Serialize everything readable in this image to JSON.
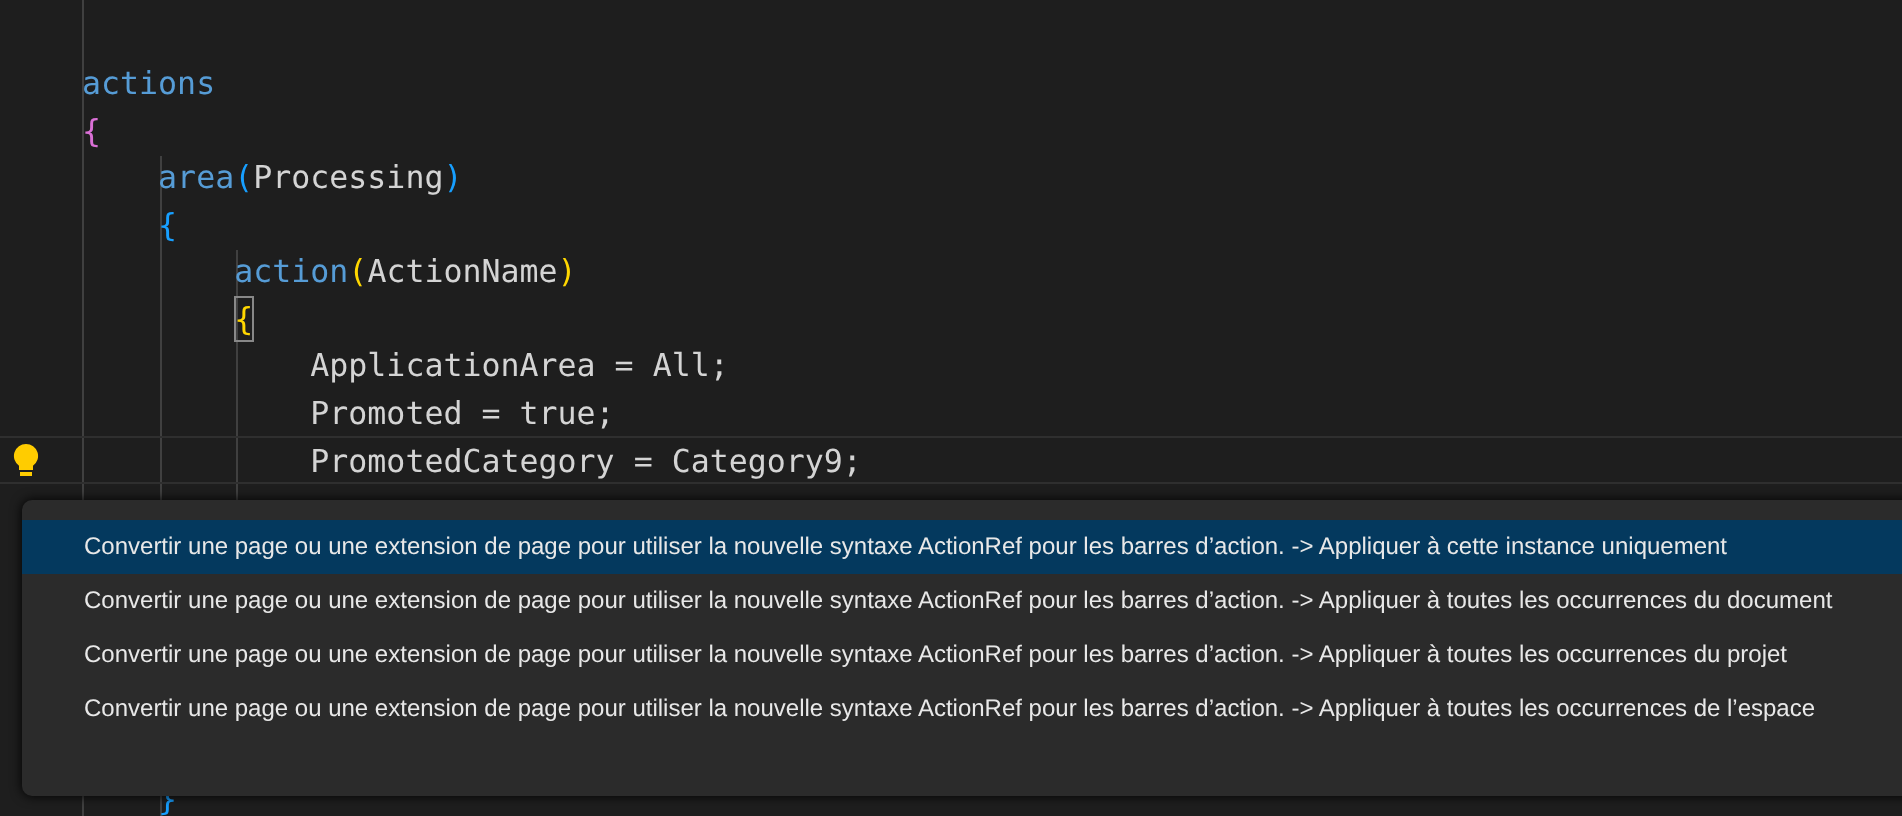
{
  "code_lines": [
    {
      "current": false,
      "lightbulb": false,
      "tokens": [
        {
          "text": "actions",
          "kind": "keyword",
          "highlighted": false
        }
      ]
    },
    {
      "current": false,
      "lightbulb": false,
      "tokens": [
        {
          "text": "{",
          "kind": "bracket2",
          "highlighted": false
        }
      ]
    },
    {
      "current": false,
      "lightbulb": false,
      "tokens": [
        {
          "text": "    area",
          "kind": "keyword",
          "highlighted": false
        },
        {
          "text": "(",
          "kind": "bracket3",
          "highlighted": false
        },
        {
          "text": "Processing",
          "kind": "plain",
          "highlighted": false
        },
        {
          "text": ")",
          "kind": "bracket3",
          "highlighted": false
        }
      ]
    },
    {
      "current": false,
      "lightbulb": false,
      "tokens": [
        {
          "text": "    {",
          "kind": "bracket3",
          "highlighted": false
        }
      ]
    },
    {
      "current": false,
      "lightbulb": false,
      "tokens": [
        {
          "text": "        action",
          "kind": "keyword",
          "highlighted": false
        },
        {
          "text": "(",
          "kind": "bracket1",
          "highlighted": false
        },
        {
          "text": "ActionName",
          "kind": "plain",
          "highlighted": false
        },
        {
          "text": ")",
          "kind": "bracket1",
          "highlighted": false
        }
      ]
    },
    {
      "current": false,
      "lightbulb": false,
      "tokens": [
        {
          "text": "        {",
          "kind": "bracket1",
          "highlighted": true
        }
      ]
    },
    {
      "current": false,
      "lightbulb": false,
      "tokens": [
        {
          "text": "            ApplicationArea = All;",
          "kind": "plain",
          "highlighted": false
        }
      ]
    },
    {
      "current": false,
      "lightbulb": false,
      "tokens": [
        {
          "text": "            Promoted = true;",
          "kind": "plain",
          "highlighted": false
        }
      ]
    },
    {
      "current": true,
      "lightbulb": true,
      "tokens": [
        {
          "text": "            PromotedCategory = Category9;",
          "kind": "plain",
          "highlighted": false
        }
      ]
    }
  ],
  "closing_line": {
    "tokens": [
      {
        "text": "    }",
        "kind": "bracket3",
        "highlighted": false
      }
    ]
  },
  "quick_fix_menu": {
    "items": [
      {
        "label": "Convertir une page ou une extension de page pour utiliser la nouvelle syntaxe ActionRef pour les barres d’action. -> Appliquer à cette instance uniquement",
        "selected": true
      },
      {
        "label": "Convertir une page ou une extension de page pour utiliser la nouvelle syntaxe ActionRef pour les barres d’action. -> Appliquer à toutes les occurrences du document",
        "selected": false
      },
      {
        "label": "Convertir une page ou une extension de page pour utiliser la nouvelle syntaxe ActionRef pour les barres d’action. -> Appliquer à toutes les occurrences du projet",
        "selected": false
      },
      {
        "label": "Convertir une page ou une extension de page pour utiliser la nouvelle syntaxe ActionRef pour les barres d’action. -> Appliquer à toutes les occurrences de l’espace",
        "selected": false
      }
    ]
  }
}
